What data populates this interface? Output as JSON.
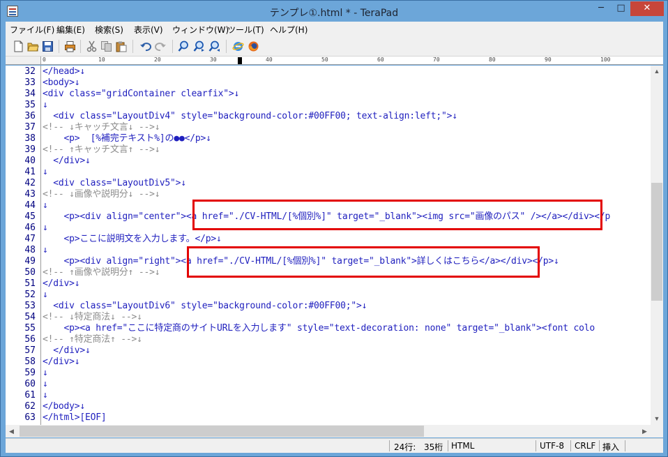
{
  "window": {
    "title": "テンプレ①.html * - TeraPad",
    "minimize_glyph": "─",
    "maximize_glyph": "□",
    "close_glyph": "✕"
  },
  "menu": [
    "ファイル(F)",
    "編集(E)",
    "検索(S)",
    "表示(V)",
    "ウィンドウ(W)",
    "ツール(T)",
    "ヘルプ(H)"
  ],
  "toolbar_icons": [
    "new-file-icon",
    "open-folder-icon",
    "save-icon",
    "print-icon",
    "cut-icon",
    "copy-icon",
    "paste-icon",
    "undo-icon",
    "redo-icon",
    "find-icon",
    "find-next-icon",
    "find-prev-icon",
    "ie-browser-icon",
    "firefox-browser-icon"
  ],
  "ruler": {
    "labels": [
      "0",
      "10",
      "20",
      "30",
      "40",
      "50",
      "60",
      "70",
      "80",
      "90",
      "100"
    ]
  },
  "editor": {
    "lines": [
      {
        "no": "32",
        "text": "</head>↓",
        "kind": "tag"
      },
      {
        "no": "33",
        "text": "<body>↓",
        "kind": "tag"
      },
      {
        "no": "34",
        "text": "<div class=\"gridContainer clearfix\">↓",
        "kind": "tag"
      },
      {
        "no": "35",
        "text": "↓",
        "kind": "tag"
      },
      {
        "no": "36",
        "text": "  <div class=\"LayoutDiv4\" style=\"background-color:#00FF00; text-align:left;\">↓",
        "kind": "tag"
      },
      {
        "no": "37",
        "text": "<!-- ↓キャッチ文言↓ -->↓",
        "kind": "comment"
      },
      {
        "no": "38",
        "text": "    <p>  [%補完テキスト%]の●●</p>↓",
        "kind": "tag"
      },
      {
        "no": "39",
        "text": "<!-- ↑キャッチ文言↑ -->↓",
        "kind": "comment"
      },
      {
        "no": "40",
        "text": "  </div>↓",
        "kind": "tag"
      },
      {
        "no": "41",
        "text": "↓",
        "kind": "tag"
      },
      {
        "no": "42",
        "text": "  <div class=\"LayoutDiv5\">↓",
        "kind": "tag"
      },
      {
        "no": "43",
        "text": "<!-- ↓画像や説明分↓ -->↓",
        "kind": "comment"
      },
      {
        "no": "44",
        "text": "↓",
        "kind": "tag"
      },
      {
        "no": "45",
        "text": "    <p><div align=\"center\"><a href=\"./CV-HTML/[%個別%]\" target=\"_blank\"><img src=\"画像のパス\" /></a></div></p",
        "kind": "tag"
      },
      {
        "no": "46",
        "text": "↓",
        "kind": "tag"
      },
      {
        "no": "47",
        "text": "    <p>ここに説明文を入力します。</p>↓",
        "kind": "tag"
      },
      {
        "no": "48",
        "text": "↓",
        "kind": "tag"
      },
      {
        "no": "49",
        "text": "    <p><div align=\"right\"><a href=\"./CV-HTML/[%個別%]\" target=\"_blank\">詳しくはこちら</a></div></p>↓",
        "kind": "tag"
      },
      {
        "no": "50",
        "text": "<!-- ↑画像や説明分↑ -->↓",
        "kind": "comment"
      },
      {
        "no": "51",
        "text": "</div>↓",
        "kind": "tag"
      },
      {
        "no": "52",
        "text": "↓",
        "kind": "tag"
      },
      {
        "no": "53",
        "text": "  <div class=\"LayoutDiv6\" style=\"background-color:#00FF00;\">↓",
        "kind": "tag"
      },
      {
        "no": "54",
        "text": "<!-- ↓特定商法↓ -->↓",
        "kind": "comment"
      },
      {
        "no": "55",
        "text": "    <p><a href=\"ここに特定商のサイトURLを入力します\" style=\"text-decoration: none\" target=\"_blank\"><font colo",
        "kind": "tag"
      },
      {
        "no": "56",
        "text": "<!-- ↑特定商法↑ -->↓",
        "kind": "comment"
      },
      {
        "no": "57",
        "text": "  </div>↓",
        "kind": "tag"
      },
      {
        "no": "58",
        "text": "</div>↓",
        "kind": "tag"
      },
      {
        "no": "59",
        "text": "↓",
        "kind": "tag"
      },
      {
        "no": "60",
        "text": "↓",
        "kind": "tag"
      },
      {
        "no": "61",
        "text": "↓",
        "kind": "tag"
      },
      {
        "no": "62",
        "text": "</body>↓",
        "kind": "tag"
      },
      {
        "no": "63",
        "text": "</html>[EOF]",
        "kind": "tag"
      }
    ]
  },
  "status": {
    "row": "24行:",
    "col": "35桁",
    "mode": "HTML",
    "encoding": "UTF-8",
    "newline": "CRLF",
    "insert": "挿入"
  },
  "colors": {
    "tag_text": "#1f1fbe",
    "comment_text": "#8c8c8c",
    "line_numbers": "#000080",
    "highlight_box": "#e30000",
    "titlebar": "#6ca6d9",
    "close_button": "#c7463a"
  }
}
